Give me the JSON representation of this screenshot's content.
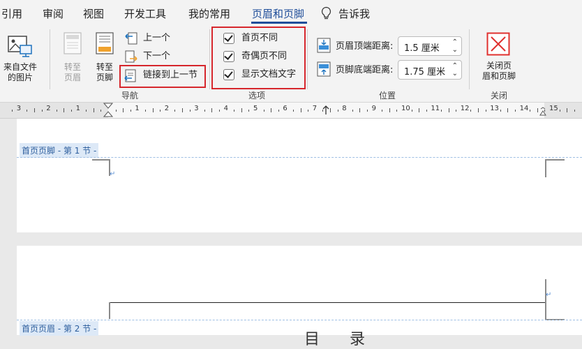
{
  "menu": {
    "tabs": [
      {
        "label": "引用"
      },
      {
        "label": "审阅"
      },
      {
        "label": "视图"
      },
      {
        "label": "开发工具"
      },
      {
        "label": "我的常用"
      },
      {
        "label": "页眉和页脚"
      },
      {
        "label": "告诉我"
      }
    ]
  },
  "ribbon": {
    "picture_from_file": "来自文件\n的图片",
    "goto_header": "转至\n页眉",
    "goto_footer": "转至\n页脚",
    "previous": "上一个",
    "next": "下一个",
    "link_to_previous": "链接到上一节",
    "nav_group": "导航",
    "options": {
      "first_page_different": "首页不同",
      "odd_even_different": "奇偶页不同",
      "show_document_text": "显示文档文字"
    },
    "options_group": "选项",
    "header_from_top_label": "页眉顶端距离:",
    "header_from_top_value": "1.5 厘米",
    "footer_from_bottom_label": "页脚底端距离:",
    "footer_from_bottom_value": "1.75 厘米",
    "position_group": "位置",
    "close_label": "关闭页\n眉和页脚",
    "close_group": "关闭",
    "colors": {
      "accent": "#1f4e9a",
      "highlight_box": "#d6262c",
      "close_icon": "#e0312f"
    }
  },
  "ruler": {
    "labels": [
      "3",
      "2",
      "1",
      "1",
      "2",
      "3",
      "4",
      "5",
      "6",
      "7",
      "8",
      "9",
      "10",
      "11",
      "12",
      "13",
      "14",
      "15"
    ]
  },
  "document": {
    "footer_tag": "首页页脚 - 第 1 节 -",
    "header_tag": "首页页眉 - 第 2 节 -",
    "partial_title": "目 录"
  }
}
